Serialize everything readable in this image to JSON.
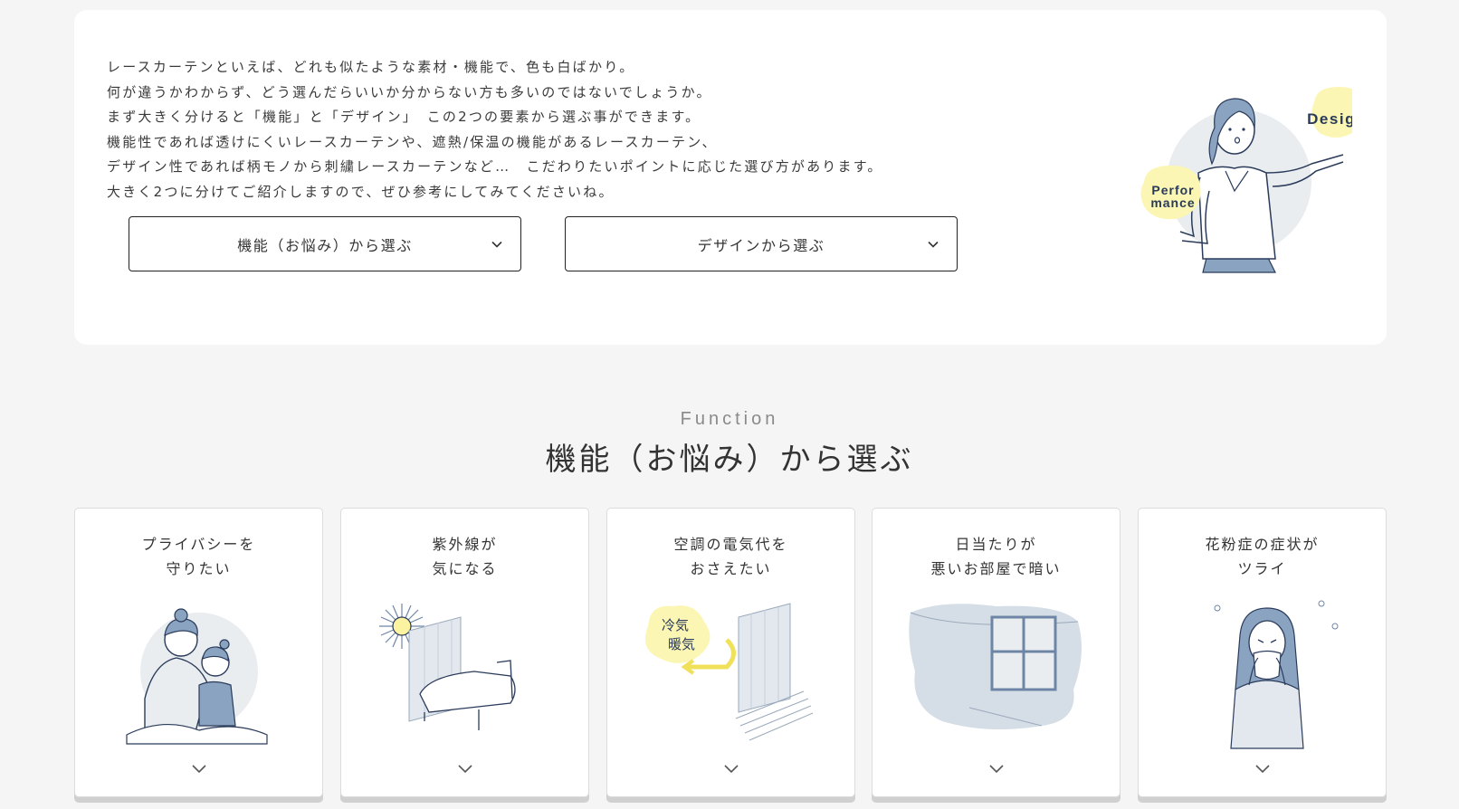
{
  "intro": {
    "lines": [
      "レースカーテンといえば、どれも似たような素材・機能で、色も白ばかり。",
      "何が違うかわからず、どう選んだらいいか分からない方も多いのではないでしょうか。",
      "まず大きく分けると「機能」と「デザイン」　この2つの要素から選ぶ事ができます。",
      "機能性であれば透けにくいレースカーテンや、遮熱/保温の機能があるレースカーテン、",
      "デザイン性であれば柄モノから刺繍レースカーテンなど…　こだわりたいポイントに応じた選び方があります。",
      "大きく2つに分けてご紹介しますので、ぜひ参考にしてみてくださいね。"
    ],
    "buttons": {
      "function_label": "機能（お悩み）から選ぶ",
      "design_label": "デザインから選ぶ"
    },
    "illustration": {
      "bubble_design": "Design",
      "bubble_performance_1": "Perfor",
      "bubble_performance_2": "mance"
    }
  },
  "section": {
    "subtitle": "Function",
    "title": "機能（お悩み）から選ぶ"
  },
  "cards": [
    {
      "line1": "プライバシーを",
      "line2": "守りたい"
    },
    {
      "line1": "紫外線が",
      "line2": "気になる"
    },
    {
      "line1": "空調の電気代を",
      "line2": "おさえたい",
      "badge1": "冷気",
      "badge2": "暖気"
    },
    {
      "line1": "日当たりが",
      "line2": "悪いお部屋で暗い"
    },
    {
      "line1": "花粉症の症状が",
      "line2": "ツライ"
    }
  ],
  "colors": {
    "accent_yellow": "#fbf6b3",
    "illus_blue": "#6e86a6",
    "illus_bg": "#e9edf0",
    "navy": "#2a3b5a"
  }
}
